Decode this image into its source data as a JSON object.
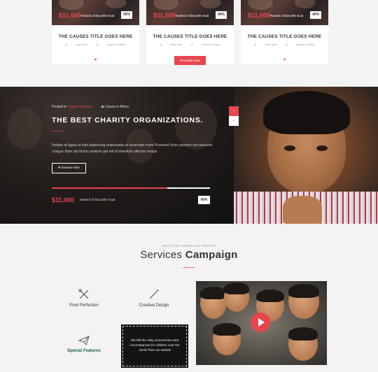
{
  "cards": [
    {
      "amount": "$11,000",
      "goal": "Raised of $15,000 Goal",
      "percent": "40%",
      "title": "THE CAUSES TITLE GOES HERE",
      "author": "John Doe",
      "location": "Cause in Africa",
      "heart": "♥"
    },
    {
      "amount": "$11,000",
      "goal": "Raised of $15,000 Goal",
      "percent": "40%",
      "title": "THE CAUSES TITLE GOES HERE",
      "author": "John Doe",
      "location": "Cause in Africa",
      "donate": "Donate Now"
    },
    {
      "amount": "$11,000",
      "goal": "Raised of $15,000 Goal",
      "percent": "40%",
      "title": "THE CAUSES TITLE GOES HERE",
      "author": "John Doe",
      "location": "Cause in Africa",
      "heart": "♥"
    }
  ],
  "hero": {
    "posted_label": "Posted in:",
    "posted_category": "Urgent Causes",
    "location": "Cause in Africa",
    "title": "THE BEST CHARITY ORGANIZATIONS.",
    "description": "Nullam at ligula at velit adipiscing malesuada et venenatis enim Praesent Nunc pretium nisl placerat congue Nam dui lectus pretium get elit id interdum ultricies neque.",
    "donate_label": "Donate Now",
    "progress": 0.73,
    "amount": "$11,000",
    "goal": "Raised of $15,000 Goal",
    "percent": "40%",
    "slider_up": "›",
    "slider_down": "‹"
  },
  "services": {
    "subtitle": "HELP THE HOMELESS PEOPLE",
    "title_light": "Services",
    "title_bold": "Campaign",
    "features": [
      {
        "label": "Pixel Perfection",
        "icon": "pencil-ruler-icon"
      },
      {
        "label": "Creative Design",
        "icon": "magic-wand-icon"
      },
      {
        "label": "Special Features",
        "icon": "paper-plane-icon"
      }
    ],
    "textbox": "We felt the risky environment and circumstances for children over the world Then we started"
  },
  "colors": {
    "accent": "#e8454f",
    "dark": "#141414",
    "green": "#1f5a4c"
  }
}
